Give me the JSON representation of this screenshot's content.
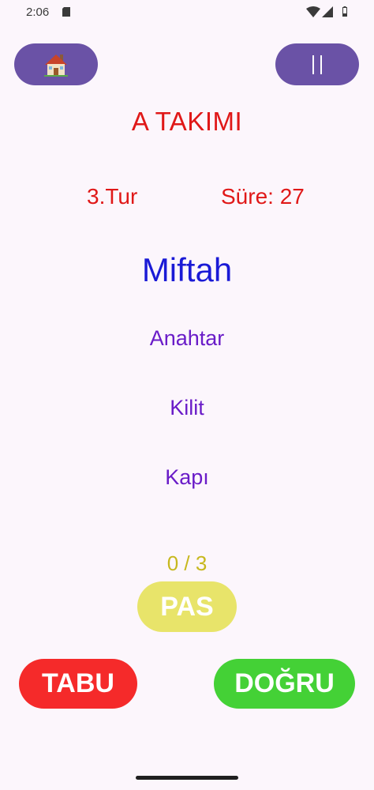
{
  "status_bar": {
    "time": "2:06",
    "icons": [
      "sd-card-icon",
      "wifi-icon",
      "signal-icon",
      "battery-icon"
    ]
  },
  "toolbar": {
    "home_icon": "house-icon",
    "pause_icon": "pause-icon",
    "button_color": "#6a52a6"
  },
  "game": {
    "team_title": "A TAKIMI",
    "round_label": "3.Tur",
    "time_label": "Süre: 27",
    "main_word": "Miftah",
    "forbidden_words": [
      "Anahtar",
      "Kilit",
      "Kapı"
    ],
    "pass_counter": "0 / 3"
  },
  "actions": {
    "pas_label": "PAS",
    "tabu_label": "TABU",
    "dogru_label": "DOĞRU"
  },
  "colors": {
    "team": "#e01818",
    "main_word": "#1a1ad6",
    "forbidden": "#6a1cc8",
    "pass_counter": "#c7b81e",
    "pas_button": "#e8e46a",
    "tabu_button": "#f52a2a",
    "dogru_button": "#44d136",
    "background": "#fcf6fc"
  }
}
